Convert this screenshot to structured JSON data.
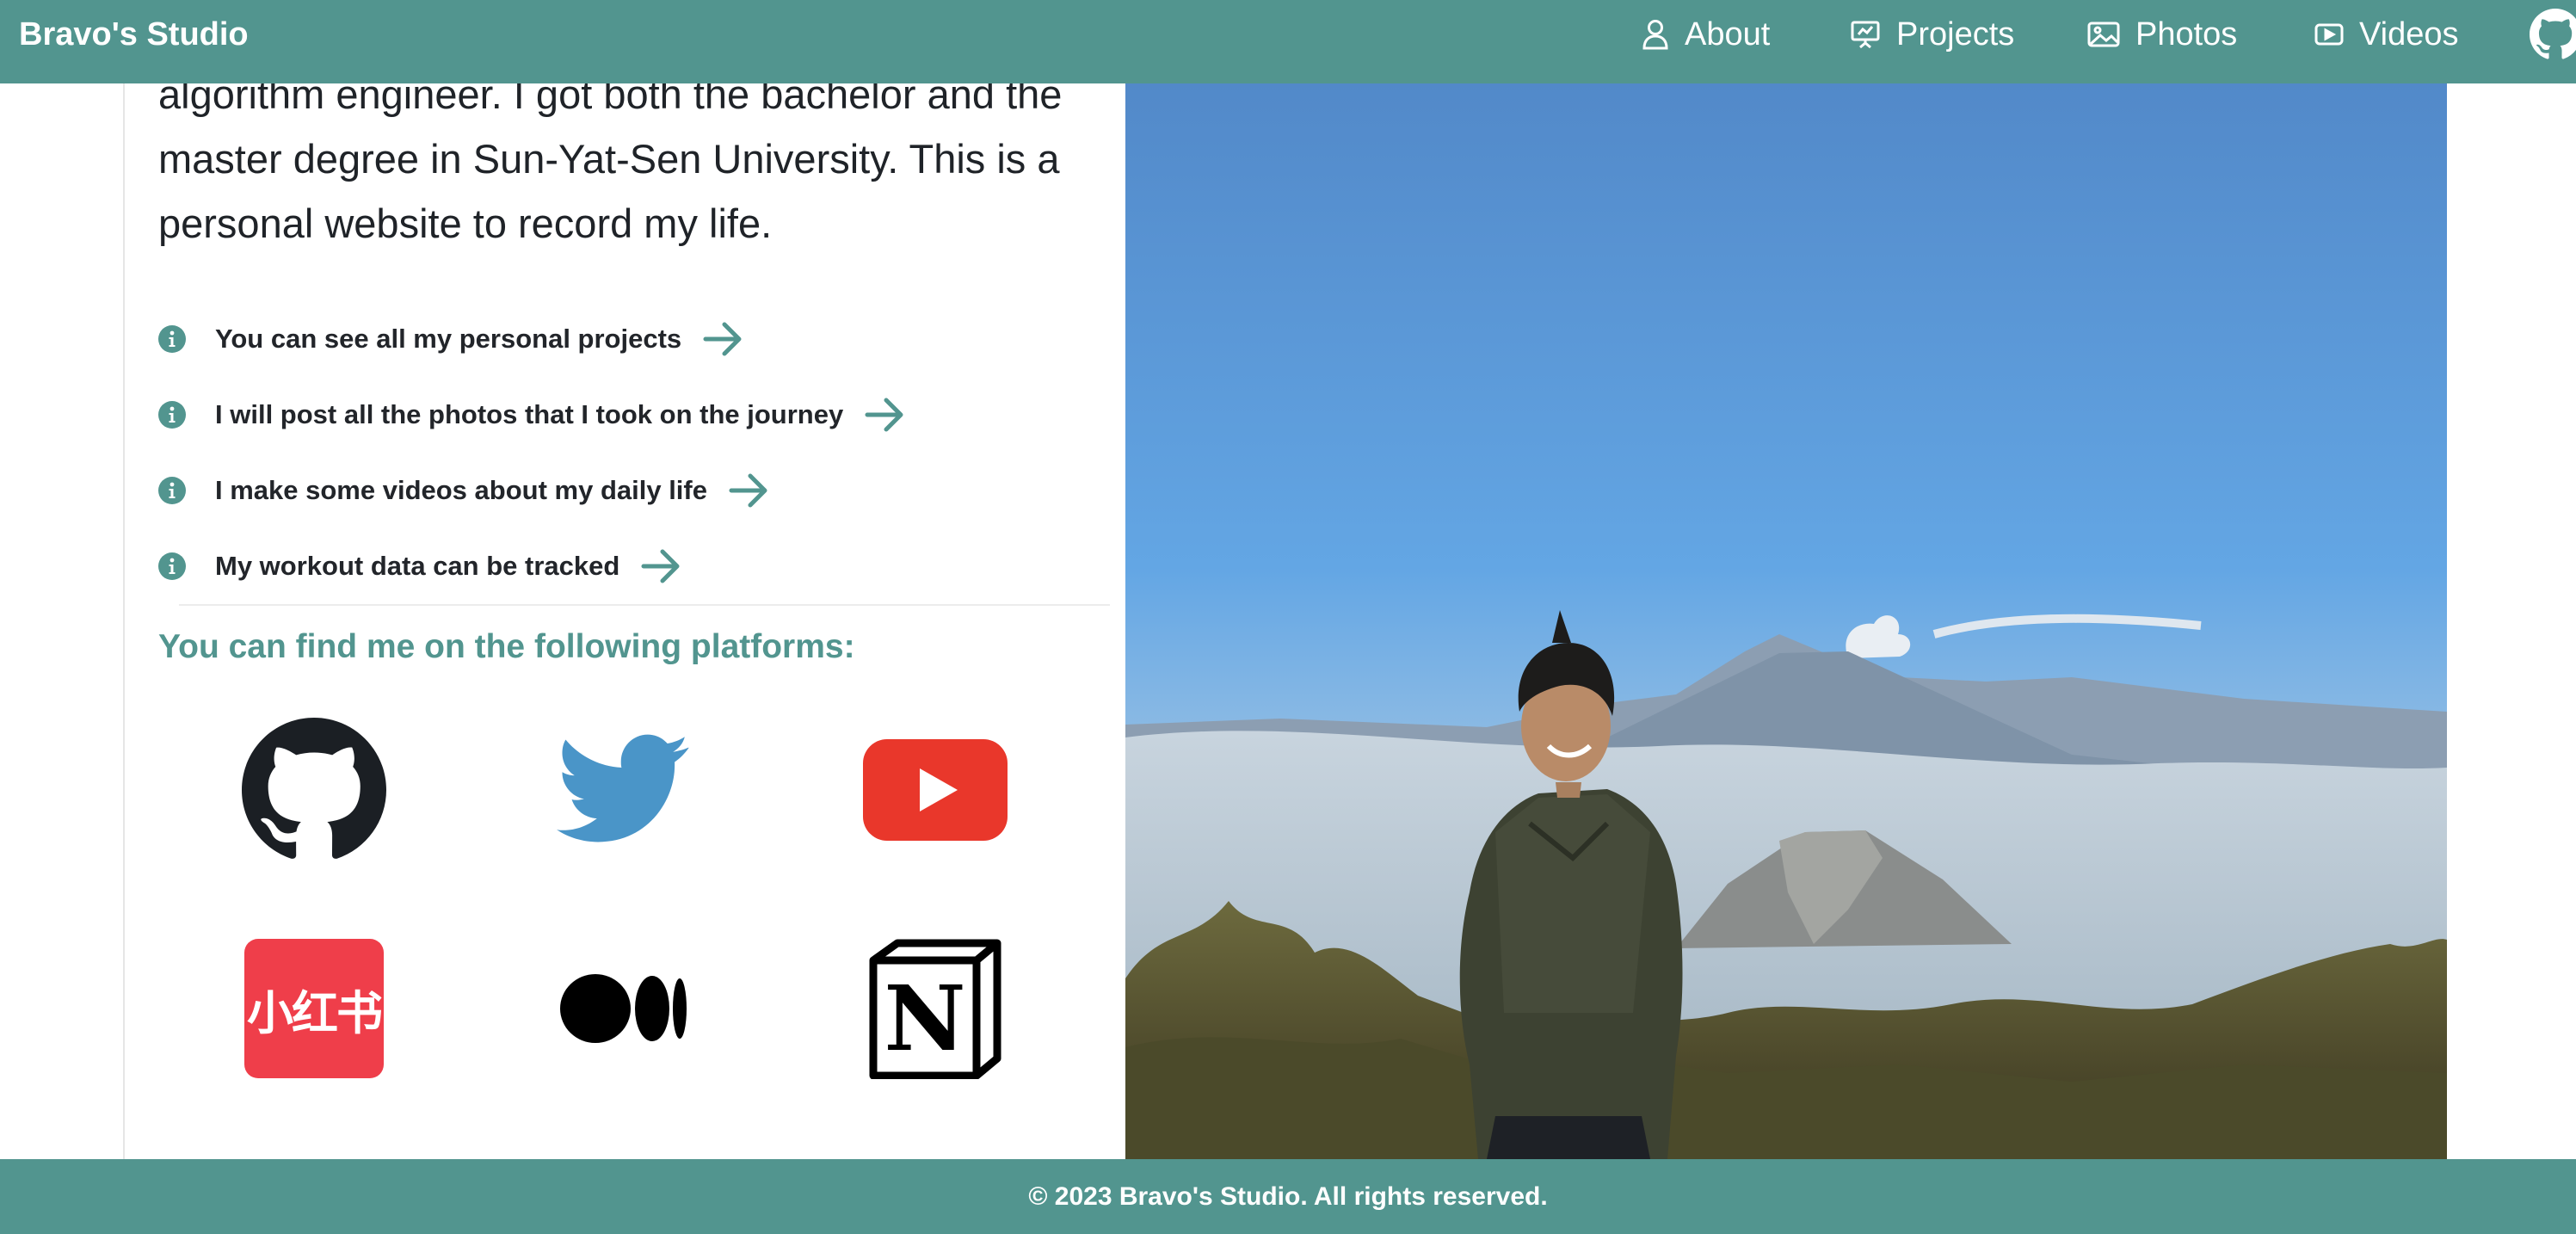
{
  "navbar": {
    "brand": "Bravo's Studio",
    "items": [
      {
        "label": "About",
        "icon": "user-icon"
      },
      {
        "label": "Projects",
        "icon": "presentation-icon"
      },
      {
        "label": "Photos",
        "icon": "image-icon"
      },
      {
        "label": "Videos",
        "icon": "video-icon"
      }
    ],
    "github_icon": "github-icon",
    "background_color": "#52958f"
  },
  "intro": {
    "lines": [
      "algorithm engineer. I got both the bachelor and the",
      "master degree in Sun-Yat-Sen University. This is a",
      "personal website to record my life."
    ]
  },
  "features": [
    {
      "text": "You can see all my personal projects",
      "icon": "info-icon",
      "action_icon": "arrow-right-icon"
    },
    {
      "text": "I will post all the photos that I took on the journey",
      "icon": "info-icon",
      "action_icon": "arrow-right-icon"
    },
    {
      "text": "I make some videos about my daily life",
      "icon": "info-icon",
      "action_icon": "arrow-right-icon"
    },
    {
      "text": "My workout data can be tracked",
      "icon": "info-icon",
      "action_icon": "arrow-right-icon"
    }
  ],
  "platforms": {
    "heading": "You can find me on the following platforms:",
    "items": [
      {
        "name": "GitHub",
        "icon": "github-icon"
      },
      {
        "name": "Twitter",
        "icon": "twitter-icon"
      },
      {
        "name": "YouTube",
        "icon": "youtube-icon"
      },
      {
        "name": "Xiaohongshu",
        "icon": "xiaohongshu-icon",
        "logo_text": "小红书"
      },
      {
        "name": "Medium",
        "icon": "medium-icon"
      },
      {
        "name": "Notion",
        "icon": "notion-icon",
        "logo_text": "N"
      }
    ]
  },
  "footer": {
    "text": "© 2023 Bravo's Studio. All rights reserved."
  },
  "colors": {
    "accent": "#52958f",
    "youtube_red": "#e9372b",
    "twitter_blue": "#4a95c8",
    "xiaohongshu_red": "#ef3e4a"
  }
}
